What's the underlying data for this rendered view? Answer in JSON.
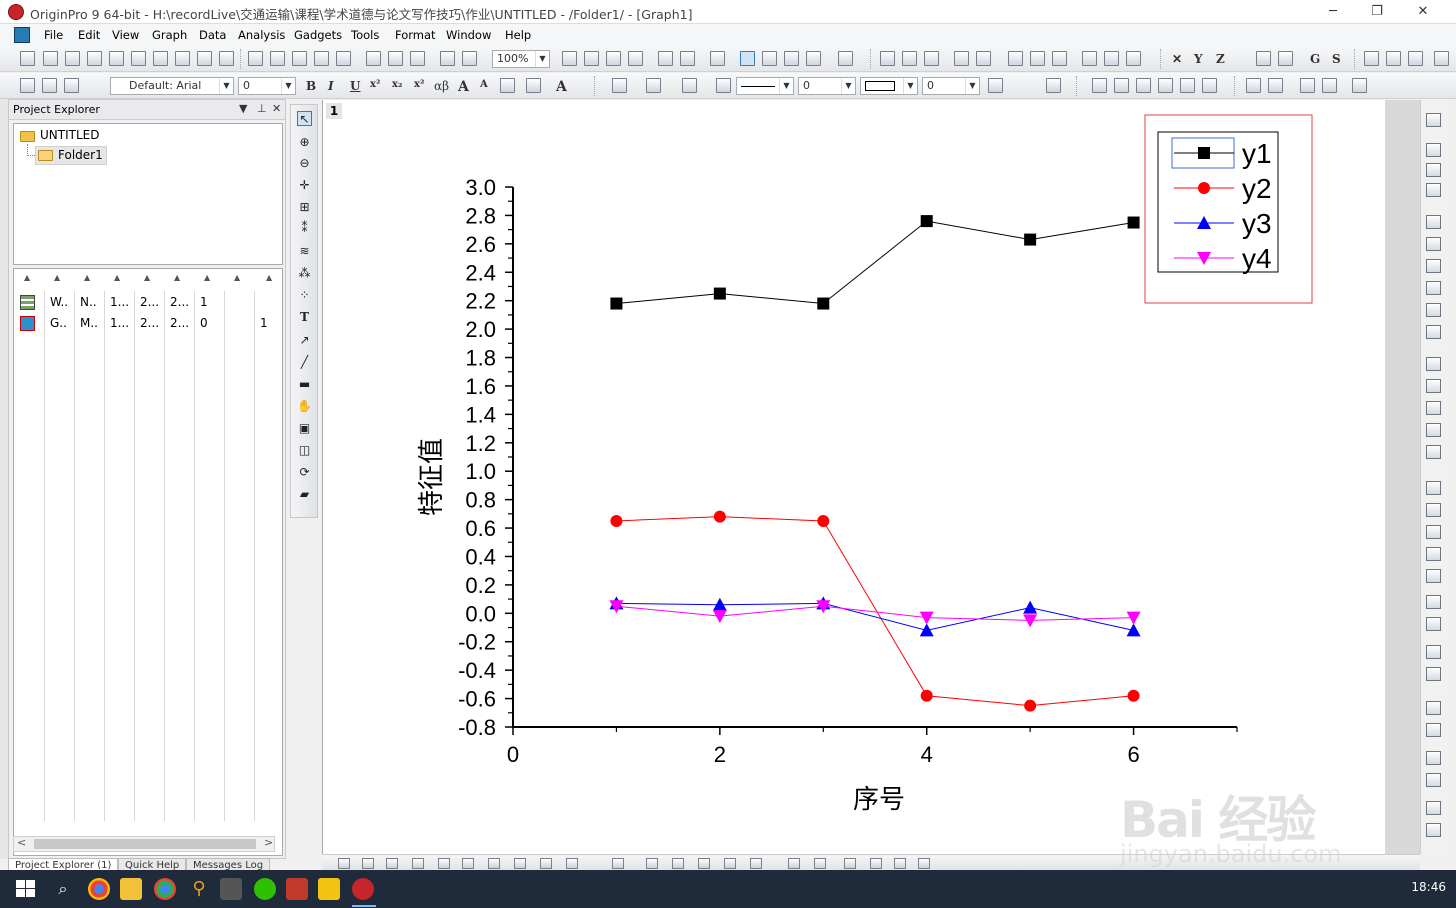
{
  "window": {
    "title": "OriginPro 9 64-bit - H:\\recordLive\\交通运输\\课程\\学术道德与论文写作技巧\\作业\\UNTITLED - /Folder1/ - [Graph1]"
  },
  "menu": [
    "File",
    "Edit",
    "View",
    "Graph",
    "Data",
    "Analysis",
    "Gadgets",
    "Tools",
    "Format",
    "Window",
    "Help"
  ],
  "toolbar": {
    "zoom": "100%",
    "font": "Default: Arial",
    "font_size": "0",
    "line_width": "0",
    "pattern_value": "0",
    "bold": "B",
    "italic": "I",
    "underline": "U",
    "greek": "αβ",
    "coord_x": "X",
    "coord_y": "Y",
    "coord_z": "Z",
    "g_label": "G",
    "s_label": "S"
  },
  "project_explorer": {
    "title": "Project Explorer",
    "root": "UNTITLED",
    "folder": "Folder1",
    "rows": [
      {
        "c1": "W..",
        "c2": "N..",
        "c3": "1...",
        "c4": "2...",
        "c5": "2...",
        "c6": "1",
        "c7": ""
      },
      {
        "c1": "G..",
        "c2": "M..",
        "c3": "1...",
        "c4": "2...",
        "c5": "2...",
        "c6": "0",
        "c7": "1"
      }
    ],
    "tabs": [
      "Project Explorer (1)",
      "Quick Help",
      "Messages Log"
    ]
  },
  "graph": {
    "tab": "1"
  },
  "chart_data": {
    "type": "line",
    "xlabel": "序号",
    "ylabel": "特征值",
    "xlim": [
      0,
      7
    ],
    "ylim": [
      -0.8,
      3.0
    ],
    "xticks": [
      "0",
      "2",
      "4",
      "6"
    ],
    "xtick_values": [
      0,
      2,
      4,
      6
    ],
    "yticks": [
      "-0.8",
      "-0.6",
      "-0.4",
      "-0.2",
      "0.0",
      "0.2",
      "0.4",
      "0.6",
      "0.8",
      "1.0",
      "1.2",
      "1.4",
      "1.6",
      "1.8",
      "2.0",
      "2.2",
      "2.4",
      "2.6",
      "2.8",
      "3.0"
    ],
    "ytick_values": [
      -0.8,
      -0.6,
      -0.4,
      -0.2,
      0.0,
      0.2,
      0.4,
      0.6,
      0.8,
      1.0,
      1.2,
      1.4,
      1.6,
      1.8,
      2.0,
      2.2,
      2.4,
      2.6,
      2.8,
      3.0
    ],
    "x": [
      1,
      2,
      3,
      4,
      5,
      6
    ],
    "series": [
      {
        "name": "y1",
        "color": "#000000",
        "marker": "square",
        "values": [
          2.18,
          2.25,
          2.18,
          2.76,
          2.63,
          2.75
        ]
      },
      {
        "name": "y2",
        "color": "#ff0000",
        "marker": "circle",
        "values": [
          0.65,
          0.68,
          0.65,
          -0.58,
          -0.65,
          -0.58
        ]
      },
      {
        "name": "y3",
        "color": "#0000ff",
        "marker": "triangle-up",
        "values": [
          0.07,
          0.06,
          0.07,
          -0.12,
          0.04,
          -0.12
        ]
      },
      {
        "name": "y4",
        "color": "#ff00ff",
        "marker": "triangle-down",
        "values": [
          0.05,
          -0.02,
          0.05,
          -0.03,
          -0.05,
          -0.03
        ]
      }
    ],
    "legend": "top-right",
    "grid": false
  },
  "taskbar": {
    "clock": "18:46"
  },
  "watermark": {
    "text1": "Bai 经验",
    "text2": "jingyan.baidu.com"
  }
}
